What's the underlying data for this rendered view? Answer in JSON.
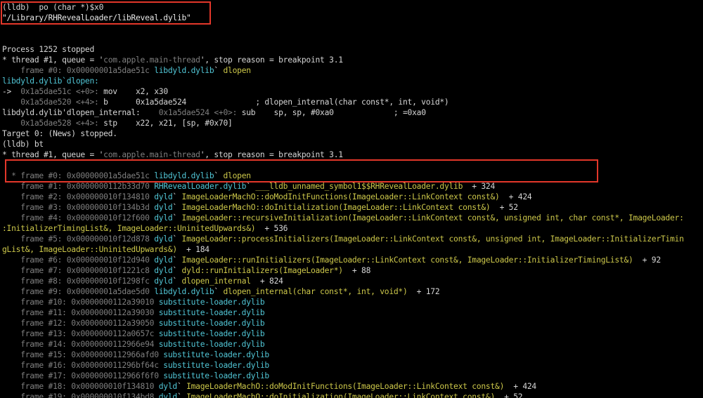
{
  "colors": {
    "background": "#000000",
    "text": "#d6d6d6",
    "dim": "#7f7f7f",
    "cyan": "#51c6d6",
    "yellow": "#cdc84a",
    "highlight_box": "#e3372a"
  },
  "highlights": [
    {
      "name": "dylib-path-highlight",
      "covers_lines": [
        0,
        1
      ]
    },
    {
      "name": "backtrace-frames-highlight",
      "covers_lines": [
        16,
        17
      ]
    }
  ],
  "lines": [
    [
      {
        "t": "(lldb)  po (char *)$x0",
        "c": "text"
      }
    ],
    [
      {
        "t": "\"/Library/RHRevealLoader/libReveal.dylib\"",
        "c": "white"
      }
    ],
    [],
    [],
    [
      {
        "t": "Process 1252 stopped",
        "c": "text"
      }
    ],
    [
      {
        "t": "* thread #1, queue = '",
        "c": "text"
      },
      {
        "t": "com.apple.main-thread",
        "c": "dim"
      },
      {
        "t": "', stop reason = breakpoint 3.1",
        "c": "text"
      }
    ],
    [
      {
        "t": "    frame #0: 0x00000001a5dae51c ",
        "c": "dim"
      },
      {
        "t": "libdyld.dylib",
        "c": "cyan"
      },
      {
        "t": "` ",
        "c": "text"
      },
      {
        "t": "dlopen",
        "c": "yellow"
      }
    ],
    [
      {
        "t": "libdyld.dylib`dlopen:",
        "c": "cyan"
      }
    ],
    [
      {
        "t": "->  ",
        "c": "text"
      },
      {
        "t": "0x1a5dae51c <+0>: ",
        "c": "dim"
      },
      {
        "t": "mov    x2, x30",
        "c": "text"
      }
    ],
    [
      {
        "t": "    0x1a5dae520 <+4>: ",
        "c": "dim"
      },
      {
        "t": "b      0x1a5dae524               ; dlopen_internal(char const*, int, void*)",
        "c": "text"
      }
    ],
    [
      {
        "t": "libdyld.dylib'dlopen_internal:    ",
        "c": "text"
      },
      {
        "t": "0x1a5dae524 <+0>: ",
        "c": "dim"
      },
      {
        "t": "sub    sp, sp, #0xa0             ; =0xa0",
        "c": "text"
      }
    ],
    [
      {
        "t": "    0x1a5dae528 <+4>: ",
        "c": "dim"
      },
      {
        "t": "stp    x22, x21, [sp, #0x70]",
        "c": "text"
      }
    ],
    [
      {
        "t": "Target 0: (News) stopped.",
        "c": "text"
      }
    ],
    [
      {
        "t": "(lldb) bt",
        "c": "text"
      }
    ],
    [
      {
        "t": "* thread #1, queue = '",
        "c": "text"
      },
      {
        "t": "com.apple.main-thread",
        "c": "dim"
      },
      {
        "t": "', stop reason = breakpoint 3.1",
        "c": "text"
      }
    ],
    [],
    [
      {
        "t": "  * frame #0: 0x00000001a5dae51c ",
        "c": "dim"
      },
      {
        "t": "libdyld.dylib",
        "c": "cyan"
      },
      {
        "t": "` ",
        "c": "text"
      },
      {
        "t": "dlopen",
        "c": "yellow"
      }
    ],
    [
      {
        "t": "    frame #1: 0x0000000112b33d70 ",
        "c": "dim"
      },
      {
        "t": "RHRevealLoader.dylib",
        "c": "cyan"
      },
      {
        "t": "` ",
        "c": "text"
      },
      {
        "t": "___lldb_unnamed_symbol1$$RHRevealLoader.dylib",
        "c": "yellow"
      },
      {
        "t": "  + 324",
        "c": "text"
      }
    ],
    [
      {
        "t": "    frame #2: 0x000000010f134810 ",
        "c": "dim"
      },
      {
        "t": "dyld",
        "c": "cyan"
      },
      {
        "t": "` ",
        "c": "text"
      },
      {
        "t": "ImageLoaderMachO::doModInitFunctions(ImageLoader::LinkContext const&)",
        "c": "yellow"
      },
      {
        "t": "  + 424",
        "c": "text"
      }
    ],
    [
      {
        "t": "    frame #3: 0x000000010f134b3d ",
        "c": "dim"
      },
      {
        "t": "dyld",
        "c": "cyan"
      },
      {
        "t": "` ",
        "c": "text"
      },
      {
        "t": "ImageLoaderMachO::doInitialization(ImageLoader::LinkContext const&)",
        "c": "yellow"
      },
      {
        "t": "  + 52",
        "c": "text"
      }
    ],
    [
      {
        "t": "    frame #4: 0x000000010f12f600 ",
        "c": "dim"
      },
      {
        "t": "dyld",
        "c": "cyan"
      },
      {
        "t": "` ",
        "c": "text"
      },
      {
        "t": "ImageLoader::recursiveInitialization(ImageLoader::LinkContext const&, unsigned int, char const*, ImageLoader:",
        "c": "yellow"
      }
    ],
    [
      {
        "t": ":InitializerTimingList&, ImageLoader::UninitedUpwards&)",
        "c": "yellow"
      },
      {
        "t": "  + 536",
        "c": "text"
      }
    ],
    [
      {
        "t": "    frame #5: 0x000000010f12d878 ",
        "c": "dim"
      },
      {
        "t": "dyld",
        "c": "cyan"
      },
      {
        "t": "` ",
        "c": "text"
      },
      {
        "t": "ImageLoader::processInitializers(ImageLoader::LinkContext const&, unsigned int, ImageLoader::InitializerTimin",
        "c": "yellow"
      }
    ],
    [
      {
        "t": "gList&, ImageLoader::UninitedUpwards&)",
        "c": "yellow"
      },
      {
        "t": "  + 184",
        "c": "text"
      }
    ],
    [
      {
        "t": "    frame #6: 0x000000010f12d940 ",
        "c": "dim"
      },
      {
        "t": "dyld",
        "c": "cyan"
      },
      {
        "t": "` ",
        "c": "text"
      },
      {
        "t": "ImageLoader::runInitializers(ImageLoader::LinkContext const&, ImageLoader::InitializerTimingList&)",
        "c": "yellow"
      },
      {
        "t": "  + 92",
        "c": "text"
      }
    ],
    [
      {
        "t": "    frame #7: 0x000000010f1221c8 ",
        "c": "dim"
      },
      {
        "t": "dyld",
        "c": "cyan"
      },
      {
        "t": "` ",
        "c": "text"
      },
      {
        "t": "dyld::runInitializers(ImageLoader*)",
        "c": "yellow"
      },
      {
        "t": "  + 88",
        "c": "text"
      }
    ],
    [
      {
        "t": "    frame #8: 0x000000010f1298fc ",
        "c": "dim"
      },
      {
        "t": "dyld",
        "c": "cyan"
      },
      {
        "t": "` ",
        "c": "text"
      },
      {
        "t": "dlopen_internal",
        "c": "yellow"
      },
      {
        "t": "  + 824",
        "c": "text"
      }
    ],
    [
      {
        "t": "    frame #9: 0x00000001a5dae5d0 ",
        "c": "dim"
      },
      {
        "t": "libdyld.dylib",
        "c": "cyan"
      },
      {
        "t": "` ",
        "c": "text"
      },
      {
        "t": "dlopen_internal(char const*, int, void*)",
        "c": "yellow"
      },
      {
        "t": "  + 172",
        "c": "text"
      }
    ],
    [
      {
        "t": "    frame #10: 0x0000000112a39010 ",
        "c": "dim"
      },
      {
        "t": "substitute-loader.dylib",
        "c": "cyan"
      }
    ],
    [
      {
        "t": "    frame #11: 0x0000000112a39030 ",
        "c": "dim"
      },
      {
        "t": "substitute-loader.dylib",
        "c": "cyan"
      }
    ],
    [
      {
        "t": "    frame #12: 0x0000000112a39050 ",
        "c": "dim"
      },
      {
        "t": "substitute-loader.dylib",
        "c": "cyan"
      }
    ],
    [
      {
        "t": "    frame #13: 0x0000000112a0657c ",
        "c": "dim"
      },
      {
        "t": "substitute-loader.dylib",
        "c": "cyan"
      }
    ],
    [
      {
        "t": "    frame #14: 0x0000000112966e94 ",
        "c": "dim"
      },
      {
        "t": "substitute-loader.dylib",
        "c": "cyan"
      }
    ],
    [
      {
        "t": "    frame #15: 0x0000000112966afd0 ",
        "c": "dim"
      },
      {
        "t": "substitute-loader.dylib",
        "c": "cyan"
      }
    ],
    [
      {
        "t": "    frame #16: 0x000000011296bf64c ",
        "c": "dim"
      },
      {
        "t": "substitute-loader.dylib",
        "c": "cyan"
      }
    ],
    [
      {
        "t": "    frame #17: 0x0000000112966f6f0 ",
        "c": "dim"
      },
      {
        "t": "substitute-loader.dylib",
        "c": "cyan"
      }
    ],
    [
      {
        "t": "    frame #18: 0x000000010f134810 ",
        "c": "dim"
      },
      {
        "t": "dyld",
        "c": "cyan"
      },
      {
        "t": "` ",
        "c": "text"
      },
      {
        "t": "ImageLoaderMachO::doModInitFunctions(ImageLoader::LinkContext const&)",
        "c": "yellow"
      },
      {
        "t": "  + 424",
        "c": "text"
      }
    ],
    [
      {
        "t": "    frame #19: 0x000000010f134bd8 ",
        "c": "dim"
      },
      {
        "t": "dyld",
        "c": "cyan"
      },
      {
        "t": "` ",
        "c": "text"
      },
      {
        "t": "ImageLoaderMachO::doInitialization(ImageLoader::LinkContext const&)",
        "c": "yellow"
      },
      {
        "t": "  + 52",
        "c": "text"
      }
    ]
  ]
}
